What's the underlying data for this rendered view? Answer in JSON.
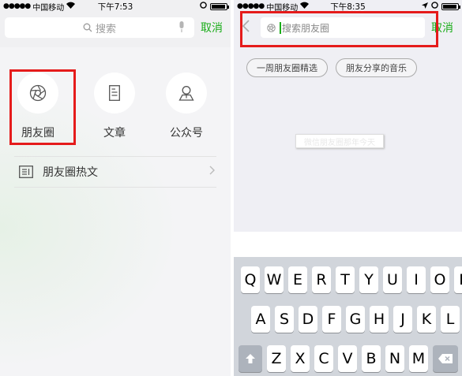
{
  "left": {
    "status": {
      "signal": "●●●●●",
      "carrier": "中国移动",
      "wifi": "wifi-icon",
      "time": "下午7:53",
      "battery_level": 0.95
    },
    "search": {
      "placeholder": "搜索",
      "cancel": "取消"
    },
    "categories": [
      {
        "label": "朋友圈",
        "icon": "moments-aperture-icon"
      },
      {
        "label": "文章",
        "icon": "article-icon"
      },
      {
        "label": "公众号",
        "icon": "official-account-icon"
      }
    ],
    "hot": {
      "label": "朋友圈热文",
      "icon": "document-icon"
    }
  },
  "right": {
    "status": {
      "signal": "●●●●●",
      "carrier": "中国移动",
      "wifi": "wifi-icon",
      "time": "下午8:35",
      "battery_level": 0.95
    },
    "search": {
      "placeholder": "搜索朋友圈",
      "cancel": "取消"
    },
    "chips": [
      "一周朋友圈精选",
      "朋友分享的音乐"
    ],
    "tooltip": "微信朋友圈那年今天",
    "keyboard": {
      "row1": [
        "Q",
        "W",
        "E",
        "R",
        "T",
        "Y",
        "U",
        "I",
        "O",
        "P"
      ],
      "row2": [
        "A",
        "S",
        "D",
        "F",
        "G",
        "H",
        "J",
        "K",
        "L"
      ],
      "row3": [
        "Z",
        "X",
        "C",
        "V",
        "B",
        "N",
        "M"
      ]
    }
  },
  "colors": {
    "accent": "#1aad19",
    "highlight": "#e51b1b"
  }
}
